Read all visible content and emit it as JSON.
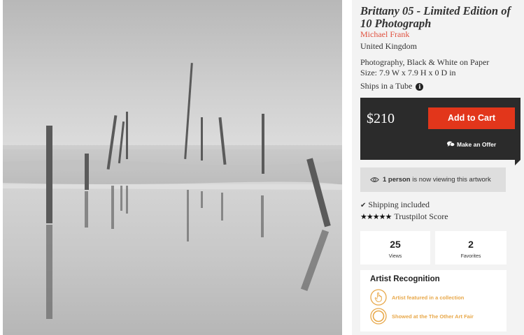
{
  "artwork": {
    "title": "Brittany 05 - Limited Edition of 10 Photograph",
    "artist": "Michael Frank",
    "country": "United Kingdom",
    "medium": "Photography, Black & White on Paper",
    "size": "Size: 7.9 W x 7.9 H x 0 D in",
    "shipping_format": "Ships in a Tube",
    "image_alt_icon": "photo"
  },
  "purchase": {
    "price": "$210",
    "add_to_cart_label": "Add to Cart",
    "make_offer_label": "Make an Offer",
    "offer_icon": "chat-bubbles-icon"
  },
  "viewing": {
    "icon": "eye-icon",
    "count_text": "1 person",
    "suffix_text": " is now viewing this artwork"
  },
  "shipping_included": "Shipping included",
  "trustpilot": {
    "stars": "★★★★★",
    "label": "Trustpilot Score"
  },
  "stats": {
    "views_count": "25",
    "views_label": "Views",
    "favorites_count": "2",
    "favorites_label": "Favorites"
  },
  "recognition": {
    "title": "Artist Recognition",
    "items": [
      {
        "icon": "hand-pointer-icon",
        "label": "Artist featured in a collection"
      },
      {
        "icon": "circle-badge-icon",
        "label": "Showed at the The Other Art Fair"
      }
    ]
  },
  "colors": {
    "accent": "#e2361b",
    "artist_link": "#e0513f",
    "recognition": "#e8a84a",
    "buybox": "#2b2b2b"
  }
}
